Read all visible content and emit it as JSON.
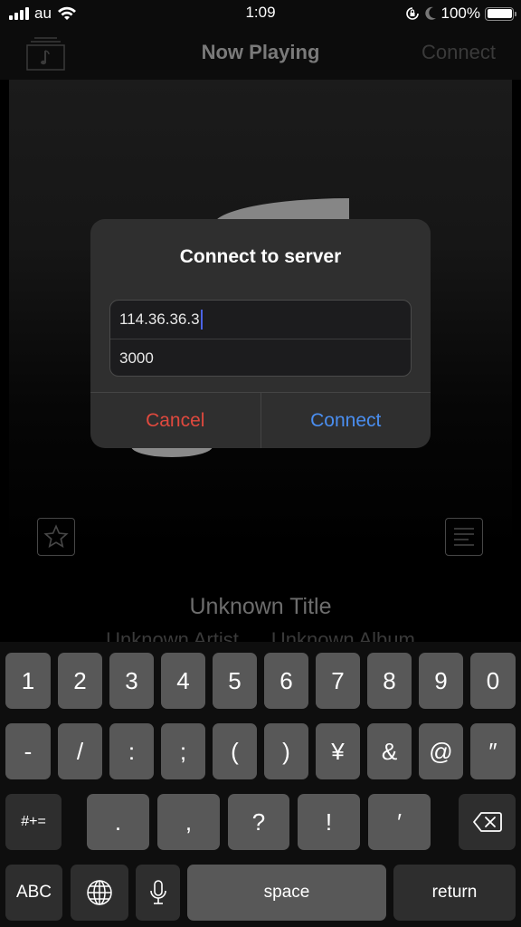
{
  "status_bar": {
    "carrier": "au",
    "time": "1:09",
    "battery": "100%",
    "icons": [
      "signal-icon",
      "wifi-icon",
      "orientation-lock-icon",
      "moon-icon",
      "battery-icon"
    ]
  },
  "nav": {
    "title": "Now Playing",
    "connect_label": "Connect",
    "left_icon": "music-library-icon"
  },
  "player": {
    "title": "Unknown Title",
    "artist": "Unknown Artist",
    "album": "Unknown Album",
    "left_icon": "star-icon",
    "right_icon": "lyrics-icon"
  },
  "alert": {
    "title": "Connect to server",
    "host_value": "114.36.36.3",
    "port_value": "3000",
    "cancel_label": "Cancel",
    "connect_label": "Connect",
    "colors": {
      "cancel": "#e0493e",
      "connect": "#4a8ef0",
      "caret": "#4a63e6"
    }
  },
  "keyboard": {
    "row1": [
      "1",
      "2",
      "3",
      "4",
      "5",
      "6",
      "7",
      "8",
      "9",
      "0"
    ],
    "row2": [
      "-",
      "/",
      ":",
      ";",
      "(",
      ")",
      "¥",
      "&",
      "@",
      "″"
    ],
    "row3": [
      "#+=",
      ".",
      ",",
      "?",
      "!",
      "′"
    ],
    "row4": {
      "abc": "ABC",
      "space": "space",
      "return": "return"
    },
    "icons": [
      "backspace-icon",
      "globe-icon",
      "microphone-icon"
    ]
  }
}
